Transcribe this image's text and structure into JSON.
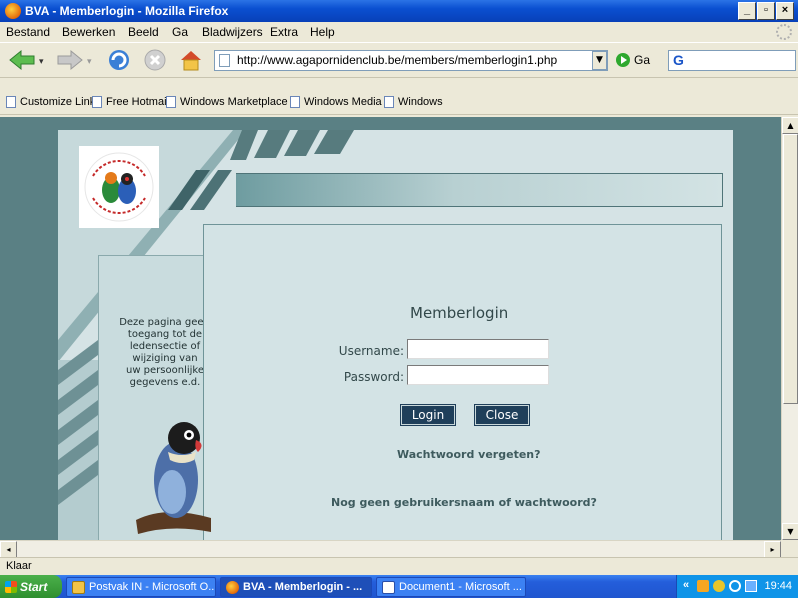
{
  "window": {
    "title": "BVA - Memberlogin - Mozilla Firefox"
  },
  "menu": [
    "Bestand",
    "Bewerken",
    "Beeld",
    "Ga",
    "Bladwijzers",
    "Extra",
    "Help"
  ],
  "nav": {
    "url": "http://www.agapornidenclub.be/members/memberlogin1.php",
    "go_label": "Ga",
    "search_engine_glyph": "G"
  },
  "bookmarks": [
    "Customize Links",
    "Free Hotmail",
    "Windows Marketplace",
    "Windows Media",
    "Windows"
  ],
  "page": {
    "logo_text": "Belgische Vereniging Agaporniden",
    "side_text": [
      "Deze pagina geeft",
      "toegang tot de",
      "ledensectie of",
      "wijziging van",
      "uw persoonlijke",
      "gegevens e.d."
    ],
    "form_title": "Memberlogin",
    "username_label": "Username:",
    "password_label": "Password:",
    "username_value": "",
    "password_value": "",
    "login_button": "Login",
    "close_button": "Close",
    "forgot_link": "Wachtwoord vergeten?",
    "register_link": "Nog geen gebruikersnaam of wachtwoord?"
  },
  "status": {
    "text": "Klaar"
  },
  "taskbar": {
    "start": "Start",
    "tasks": [
      "Postvak IN - Microsoft O...",
      "BVA - Memberlogin - ...",
      "Document1 - Microsoft ..."
    ],
    "clock": "19:44",
    "tray_chevron": "«"
  },
  "colors": {
    "page_bg": "#5a8084",
    "panel": "#d5e3e5",
    "button": "#1f3f5a",
    "link": "#3e5b5e"
  }
}
